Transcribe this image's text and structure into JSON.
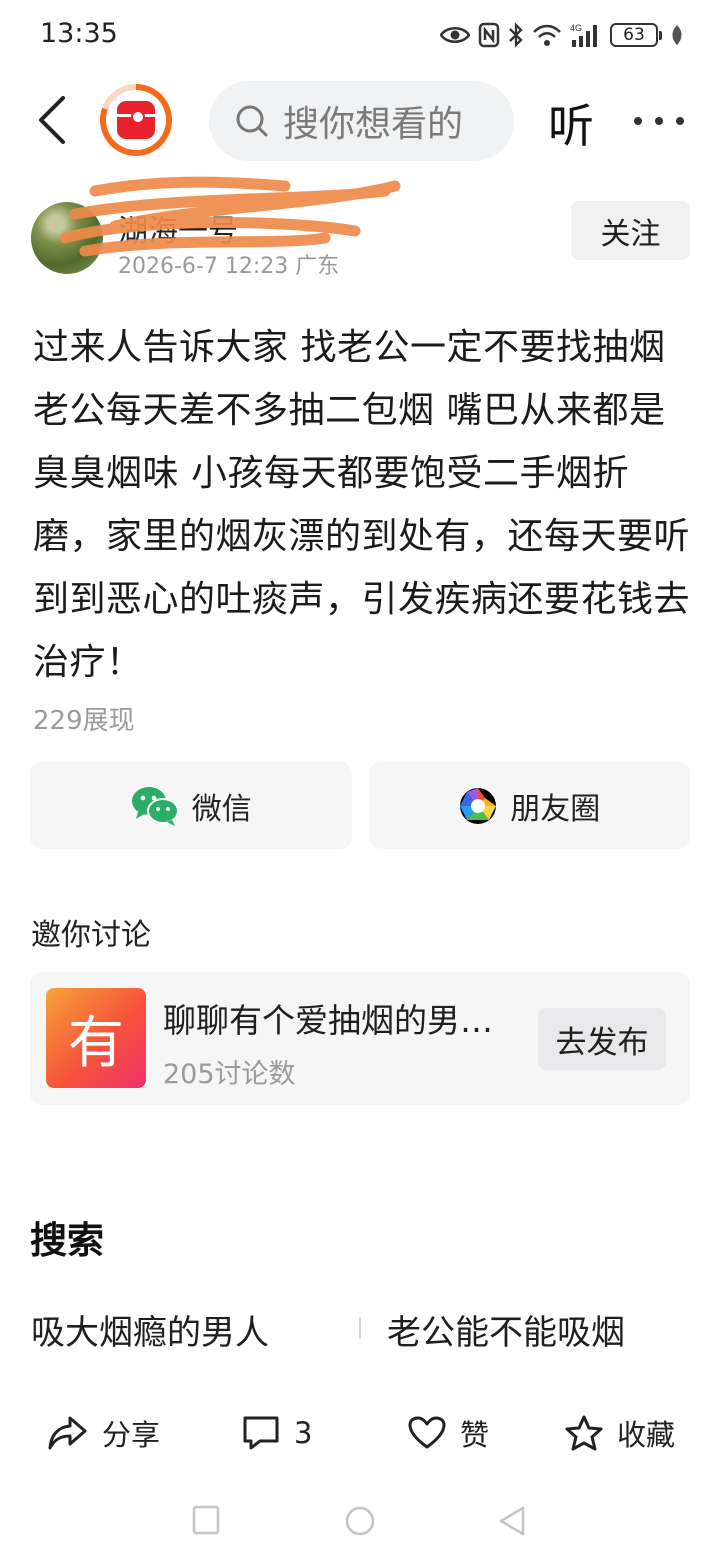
{
  "status_bar": {
    "time": "13:35",
    "battery": "63"
  },
  "top_nav": {
    "search_placeholder": "搜你想看的",
    "listen_label": "听"
  },
  "author": {
    "name": "湖海一号",
    "meta": "2026-6-7 12:23 广东",
    "follow_label": "关注"
  },
  "post": {
    "text": "过来人告诉大家 找老公一定不要找抽烟 老公每天差不多抽二包烟  嘴巴从来都是臭臭烟味 小孩每天都要饱受二手烟折磨，家里的烟灰漂的到处有，还每天要听到到恶心的吐痰声，引发疾病还要花钱去治疗！",
    "views": "229展现"
  },
  "share": {
    "wechat_label": "微信",
    "moments_label": "朋友圈"
  },
  "discussion": {
    "heading": "邀你讨论",
    "topic_icon_char": "有",
    "topic_title": "聊聊有个爱抽烟的男人是什么体验",
    "topic_count": "205讨论数",
    "publish_label": "去发布"
  },
  "search": {
    "heading": "搜索",
    "suggestions": [
      "吸大烟瘾的男人",
      "老公能不能吸烟"
    ]
  },
  "actions": {
    "share_label": "分享",
    "comment_count": "3",
    "like_label": "赞",
    "favorite_label": "收藏"
  },
  "colors": {
    "accent_orange": "#f26b1d",
    "logo_red": "#e8222c",
    "wechat_green": "#2aae67"
  }
}
